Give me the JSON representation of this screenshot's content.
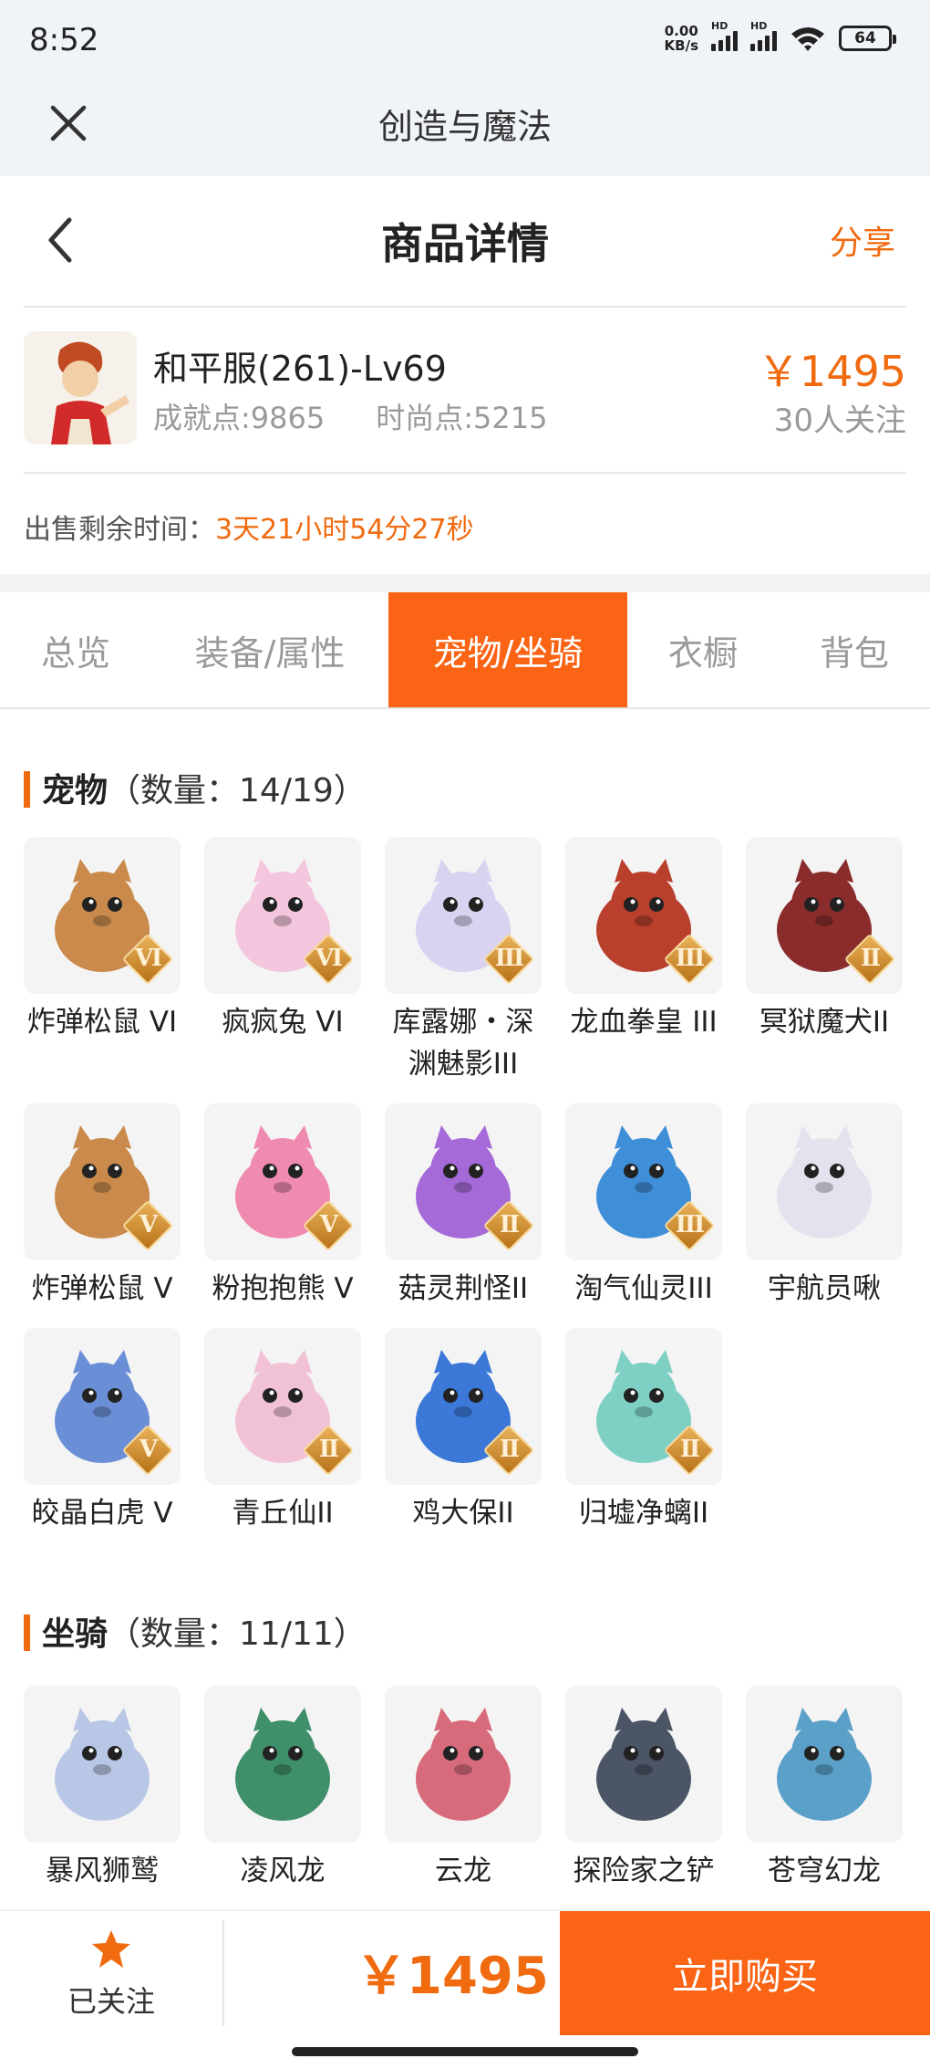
{
  "status": {
    "time": "8:52",
    "netspeed_top": "0.00",
    "netspeed_bottom": "KB/s",
    "hd": "HD",
    "battery": "64"
  },
  "appbar": {
    "title": "创造与魔法"
  },
  "header": {
    "title": "商品详情",
    "share": "分享"
  },
  "product": {
    "name": "和平服(261)-Lv69",
    "achievement": "成就点:9865",
    "fashion": "时尚点:5215",
    "price": "￥1495",
    "followers": "30人关注"
  },
  "remain": {
    "label": "出售剩余时间：",
    "countdown": "3天21小时54分27秒"
  },
  "tabs": [
    {
      "label": "总览",
      "active": false
    },
    {
      "label": "装备/属性",
      "active": false
    },
    {
      "label": "宠物/坐骑",
      "active": true
    },
    {
      "label": "衣橱",
      "active": false
    },
    {
      "label": "背包",
      "active": false
    }
  ],
  "pets": {
    "title": "宠物",
    "count": "（数量：14/19）",
    "items": [
      {
        "name": "炸弹松鼠 VI",
        "tier": "VI",
        "icon": "squirrel-icon",
        "color": "#c98a4b"
      },
      {
        "name": "疯疯兔 VI",
        "tier": "VI",
        "icon": "rabbit-icon",
        "color": "#f3c6dd"
      },
      {
        "name": "库露娜・深渊魅影III",
        "tier": "III",
        "icon": "spirit-girl-icon",
        "color": "#d9d2f0"
      },
      {
        "name": "龙血拳皇 III",
        "tier": "III",
        "icon": "horned-beast-icon",
        "color": "#b8402c"
      },
      {
        "name": "冥狱魔犬II",
        "tier": "II",
        "icon": "hellhound-icon",
        "color": "#8a2c2c"
      },
      {
        "name": "炸弹松鼠 V",
        "tier": "V",
        "icon": "squirrel-icon",
        "color": "#c98a4b"
      },
      {
        "name": "粉抱抱熊 V",
        "tier": "V",
        "icon": "pink-bear-icon",
        "color": "#ef8ab0"
      },
      {
        "name": "菇灵荆怪II",
        "tier": "II",
        "icon": "mushroom-sprite-icon",
        "color": "#a56ad8"
      },
      {
        "name": "淘气仙灵III",
        "tier": "III",
        "icon": "blue-pup-icon",
        "color": "#3f8ed8"
      },
      {
        "name": "宇航员啾",
        "tier": "",
        "icon": "astronaut-icon",
        "color": "#e3e3ee"
      },
      {
        "name": "皎晶白虎 V",
        "tier": "V",
        "icon": "white-tiger-icon",
        "color": "#6b8fd6"
      },
      {
        "name": "青丘仙II",
        "tier": "II",
        "icon": "fox-fairy-icon",
        "color": "#f1c2d6"
      },
      {
        "name": "鸡大保II",
        "tier": "II",
        "icon": "blue-bird-icon",
        "color": "#3b78d8"
      },
      {
        "name": "归墟净螭II",
        "tier": "II",
        "icon": "jade-dragon-icon",
        "color": "#7fd0c4"
      }
    ]
  },
  "mounts": {
    "title": "坐骑",
    "count": "（数量：11/11）",
    "items": [
      {
        "name": "暴风狮鹫",
        "icon": "griffin-icon",
        "color": "#b9c7e6"
      },
      {
        "name": "凌风龙",
        "icon": "green-dragon-icon",
        "color": "#3f8f6a"
      },
      {
        "name": "云龙",
        "icon": "cloud-dragon-icon",
        "color": "#d76b7c"
      },
      {
        "name": "探险家之铲",
        "icon": "shovel-icon",
        "color": "#4b5566"
      },
      {
        "name": "苍穹幻龙",
        "icon": "sky-dragon-icon",
        "color": "#5aa0c8"
      }
    ]
  },
  "bottom": {
    "follow_label": "已关注",
    "price": "￥1495",
    "buy_label": "立即购买"
  },
  "colors": {
    "accent": "#fa6414",
    "price": "#f06b10"
  }
}
